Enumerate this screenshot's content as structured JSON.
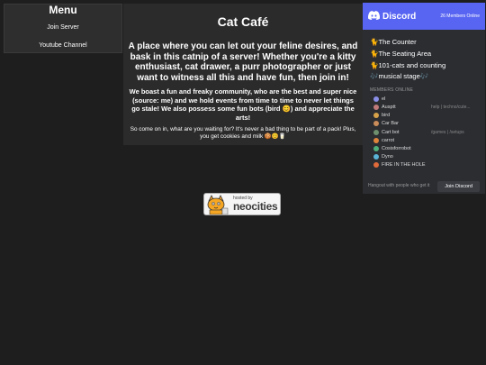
{
  "menu": {
    "title": "Menu",
    "links": [
      "Join Server",
      "Youtube Channel"
    ]
  },
  "main": {
    "title": "Cat Café",
    "lead": "A place where you can let out your feline desires, and bask in this catnip of a server! Whether you're a kitty enthusiast, cat drawer, a purr photographer or just want to witness all this and have fun, then join in!",
    "sub": "We boast a fun and freaky community, who are the best and super nice (source: me) and we hold events from time to time to never let things go stale! We also possess some fun bots (bird 😊) and appreciate the arts!",
    "small": "So come on in, what are you waiting for? It's never a bad thing to be part of a pack! Plus, you get cookies and milk 🍪😊🥛"
  },
  "badge": {
    "hosted_by": "hosted by",
    "brand": "neocities"
  },
  "discord": {
    "brand": "Discord",
    "online": "26 Members Online",
    "brand_color": "#5865f2",
    "channels": [
      "🐈The Counter",
      "🐈The Seating Area",
      "🐈101-cats and counting",
      "🎶musical stage🎶"
    ],
    "members_header": "MEMBERS ONLINE",
    "members": [
      {
        "name": "el",
        "game": "",
        "color": "#8a8fe8"
      },
      {
        "name": "Ausptt",
        "game": "help | techno/cute...",
        "color": "#c07a7a"
      },
      {
        "name": "bird",
        "game": "",
        "color": "#d6a24a"
      },
      {
        "name": "Car Bar",
        "game": "",
        "color": "#c98c5a"
      },
      {
        "name": "Cart bot",
        "game": "/games | /setups",
        "color": "#6e8f6e"
      },
      {
        "name": "carrot",
        "game": "",
        "color": "#e0843c"
      },
      {
        "name": "Cosisforrobot",
        "game": "",
        "color": "#4fb07a"
      },
      {
        "name": "Dyno",
        "game": "",
        "color": "#5ab4d8"
      },
      {
        "name": "FIRE IN THE HOLE",
        "game": "",
        "color": "#e06a3a"
      }
    ],
    "footer_text": "Hangout with people who get it",
    "join_label": "Join Discord"
  }
}
